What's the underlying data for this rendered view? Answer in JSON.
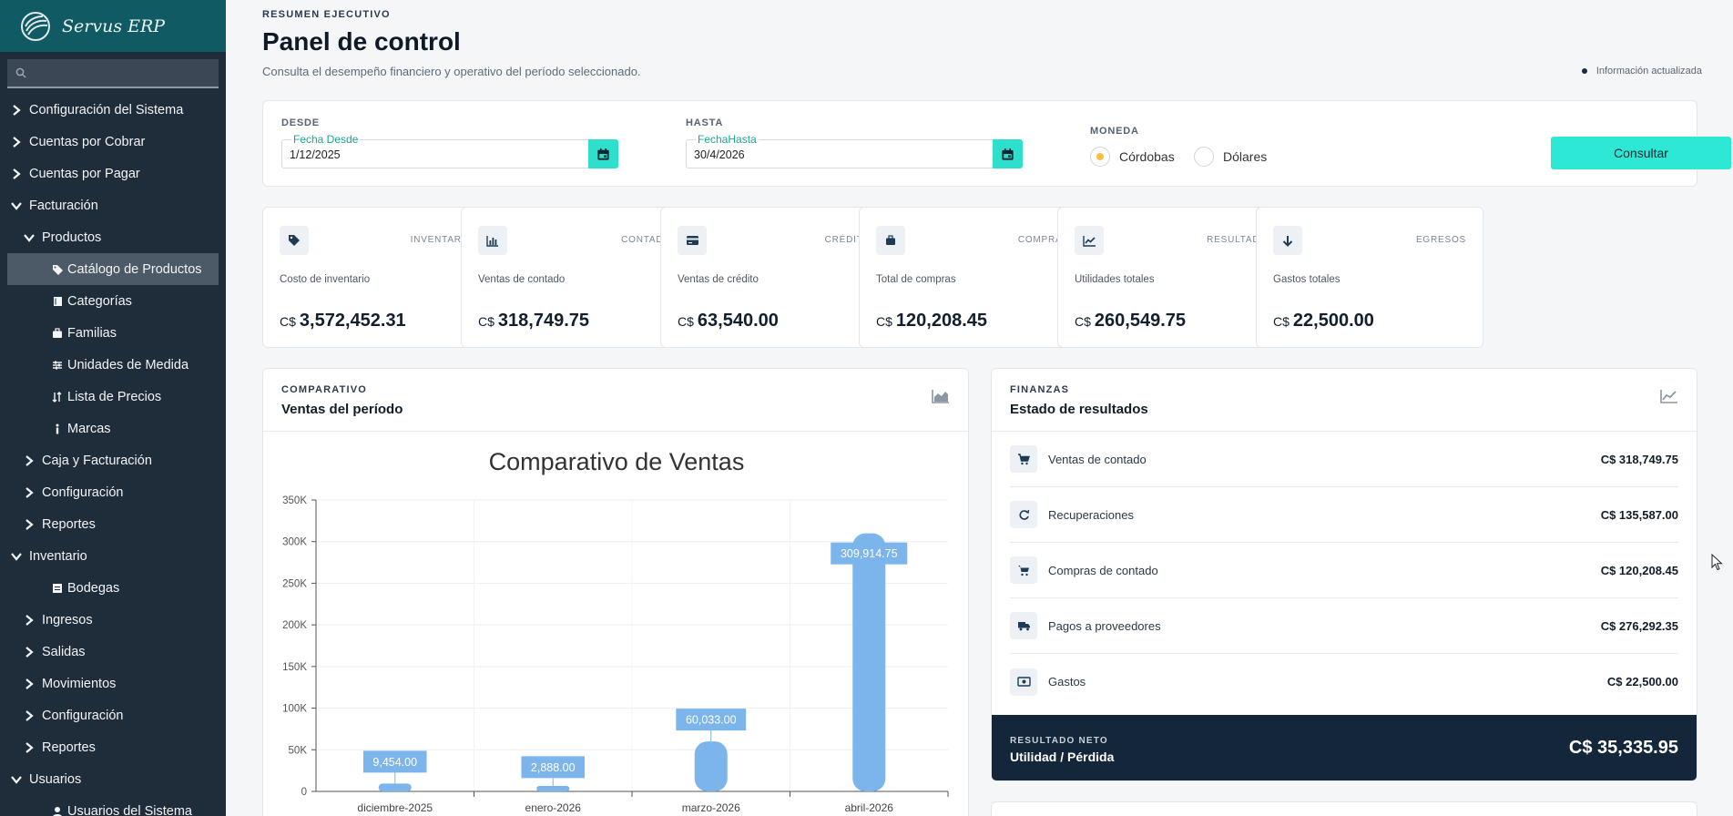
{
  "app": {
    "name": "Servus ERP"
  },
  "sidebar": {
    "search_placeholder": "",
    "items": [
      {
        "label": "Configuración del Sistema",
        "level": 0,
        "state": "collapsed"
      },
      {
        "label": "Cuentas por Cobrar",
        "level": 0,
        "state": "collapsed"
      },
      {
        "label": "Cuentas por Pagar",
        "level": 0,
        "state": "collapsed"
      },
      {
        "label": "Facturación",
        "level": 0,
        "state": "expanded"
      },
      {
        "label": "Productos",
        "level": 1,
        "state": "expanded"
      },
      {
        "label": "Catálogo de Productos",
        "level": 2,
        "icon": "tags-icon",
        "active": true
      },
      {
        "label": "Categorías",
        "level": 2,
        "icon": "book-icon"
      },
      {
        "label": "Familias",
        "level": 2,
        "icon": "briefcase-icon"
      },
      {
        "label": "Unidades de Medida",
        "level": 2,
        "icon": "sliders-icon"
      },
      {
        "label": "Lista de Precios",
        "level": 2,
        "icon": "sort-icon"
      },
      {
        "label": "Marcas",
        "level": 2,
        "icon": "info-icon"
      },
      {
        "label": "Caja y Facturación",
        "level": 1,
        "state": "collapsed"
      },
      {
        "label": "Configuración",
        "level": 1,
        "state": "collapsed"
      },
      {
        "label": "Reportes",
        "level": 1,
        "state": "collapsed"
      },
      {
        "label": "Inventario",
        "level": 0,
        "state": "expanded"
      },
      {
        "label": "Bodegas",
        "level": 2,
        "icon": "warehouse-icon"
      },
      {
        "label": "Ingresos",
        "level": 1,
        "state": "collapsed"
      },
      {
        "label": "Salidas",
        "level": 1,
        "state": "collapsed"
      },
      {
        "label": "Movimientos",
        "level": 1,
        "state": "collapsed"
      },
      {
        "label": "Configuración",
        "level": 1,
        "state": "collapsed"
      },
      {
        "label": "Reportes",
        "level": 1,
        "state": "collapsed"
      },
      {
        "label": "Usuarios",
        "level": 0,
        "state": "expanded"
      },
      {
        "label": "Usuarios del Sistema",
        "level": 2,
        "icon": "user-icon"
      }
    ]
  },
  "header": {
    "eyebrow": "RESUMEN EJECUTIVO",
    "title": "Panel de control",
    "subtitle": "Consulta el desempeño financiero y operativo del período seleccionado.",
    "status": "Información actualizada"
  },
  "filters": {
    "from_label": "DESDE",
    "from_field_label": "Fecha Desde",
    "from_value": "1/12/2025",
    "to_label": "HASTA",
    "to_field_label": "FechaHasta",
    "to_value": "30/4/2026",
    "currency_label": "MONEDA",
    "currency_options": [
      "Córdobas",
      "Dólares"
    ],
    "currency_selected": "Córdobas",
    "submit_label": "Consultar"
  },
  "kpis": [
    {
      "tag": "INVENTARIO",
      "label": "Costo de inventario",
      "currency": "C$",
      "value": "3,572,452.31",
      "icon": "tag-icon"
    },
    {
      "tag": "CONTADO",
      "label": "Ventas de contado",
      "currency": "C$",
      "value": "318,749.75",
      "icon": "bar-chart-icon"
    },
    {
      "tag": "CRÉDITO",
      "label": "Ventas de crédito",
      "currency": "C$",
      "value": "63,540.00",
      "icon": "credit-card-icon"
    },
    {
      "tag": "COMPRAS",
      "label": "Total de compras",
      "currency": "C$",
      "value": "120,208.45",
      "icon": "briefcase-icon"
    },
    {
      "tag": "RESULTADO",
      "label": "Utilidades totales",
      "currency": "C$",
      "value": "260,549.75",
      "icon": "trend-up-icon"
    },
    {
      "tag": "EGRESOS",
      "label": "Gastos totales",
      "currency": "C$",
      "value": "22,500.00",
      "icon": "arrow-down-icon"
    }
  ],
  "sales_panel": {
    "eyebrow": "COMPARATIVO",
    "title": "Ventas del período",
    "icon": "area-chart-icon"
  },
  "chart_data": {
    "type": "bar",
    "title": "Comparativo de Ventas",
    "categories": [
      "diciembre-2025",
      "enero-2026",
      "marzo-2026",
      "abril-2026"
    ],
    "values": [
      9454.0,
      2888.0,
      60033.0,
      309914.75
    ],
    "data_labels": [
      "9,454.00",
      "2,888.00",
      "60,033.00",
      "309,914.75"
    ],
    "y_ticks": [
      "0",
      "50K",
      "100K",
      "150K",
      "200K",
      "250K",
      "300K",
      "350K"
    ],
    "ylim": [
      0,
      350000
    ],
    "xlabel": "",
    "ylabel": "",
    "grid": true,
    "bar_color": "#7cb5ec",
    "label_bg": "#7cb5ec"
  },
  "results_panel": {
    "eyebrow": "FINANZAS",
    "title": "Estado de resultados",
    "icon": "line-chart-icon",
    "rows": [
      {
        "label": "Ventas de contado",
        "value": "C$ 318,749.75",
        "icon": "cart-icon"
      },
      {
        "label": "Recuperaciones",
        "value": "C$ 135,587.00",
        "icon": "refresh-icon"
      },
      {
        "label": "Compras de contado",
        "value": "C$ 120,208.45",
        "icon": "shopping-cart-icon"
      },
      {
        "label": "Pagos a proveedores",
        "value": "C$ 276,292.35",
        "icon": "truck-icon"
      },
      {
        "label": "Gastos",
        "value": "C$ 22,500.00",
        "icon": "money-icon"
      }
    ],
    "net_eyebrow": "RESULTADO NETO",
    "net_title": "Utilidad / Pérdida",
    "net_value": "C$ 35,335.95"
  },
  "colors": {
    "brand_header": "#0f5a63",
    "sidebar_bg": "#1f2c3a",
    "accent": "#2ee8d6",
    "net_bg": "#13263a"
  }
}
